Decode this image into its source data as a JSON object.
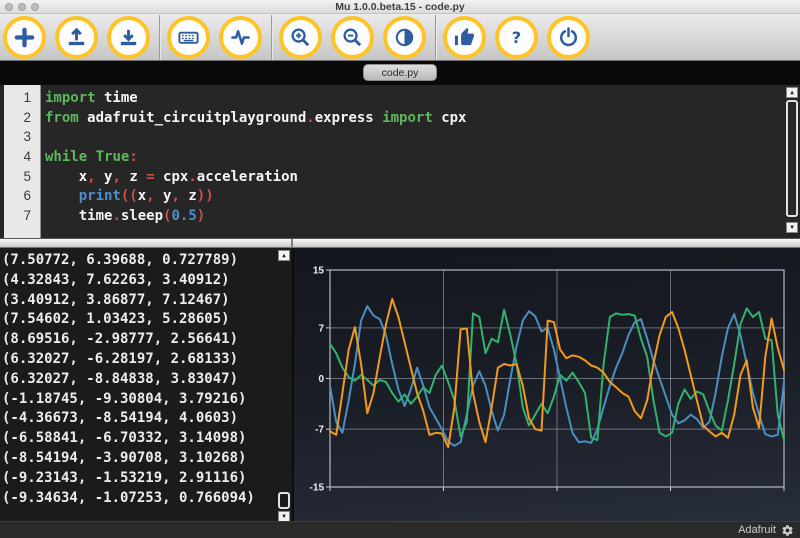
{
  "window": {
    "title": "Mu 1.0.0.beta.15 - code.py"
  },
  "toolbar": {
    "buttons": [
      {
        "id": "new",
        "icon": "plus-icon",
        "group": 1
      },
      {
        "id": "load",
        "icon": "upload-icon",
        "group": 1
      },
      {
        "id": "save",
        "icon": "download-icon",
        "group": 1
      },
      {
        "id": "serial",
        "icon": "keyboard-icon",
        "group": 2
      },
      {
        "id": "plotter",
        "icon": "waveform-icon",
        "group": 2
      },
      {
        "id": "zoom-in",
        "icon": "zoom-in-icon",
        "group": 3
      },
      {
        "id": "zoom-out",
        "icon": "zoom-out-icon",
        "group": 3
      },
      {
        "id": "theme",
        "icon": "contrast-icon",
        "group": 3
      },
      {
        "id": "check",
        "icon": "thumbs-up-icon",
        "group": 4
      },
      {
        "id": "help",
        "icon": "question-icon",
        "group": 4
      },
      {
        "id": "quit",
        "icon": "power-icon",
        "group": 4
      }
    ]
  },
  "tabs": {
    "active": "code.py"
  },
  "editor": {
    "lines": [
      {
        "num": "1",
        "tokens": [
          [
            "import",
            "kw"
          ],
          [
            " time",
            "t"
          ]
        ]
      },
      {
        "num": "2",
        "tokens": [
          [
            "from",
            "kw"
          ],
          [
            " adafruit_circuitplayground",
            "t"
          ],
          [
            ".",
            "p"
          ],
          [
            "express",
            "t"
          ],
          [
            " ",
            "t"
          ],
          [
            "import",
            "kw"
          ],
          [
            " cpx",
            "t"
          ]
        ]
      },
      {
        "num": "3",
        "tokens": []
      },
      {
        "num": "4",
        "tokens": [
          [
            "while",
            "kw"
          ],
          [
            " ",
            "t"
          ],
          [
            "True",
            "kw"
          ],
          [
            ":",
            "p"
          ]
        ]
      },
      {
        "num": "5",
        "tokens": [
          [
            "    x",
            "t"
          ],
          [
            ",",
            "p"
          ],
          [
            " y",
            "t"
          ],
          [
            ",",
            "p"
          ],
          [
            " z ",
            "t"
          ],
          [
            "=",
            "p"
          ],
          [
            " cpx",
            "t"
          ],
          [
            ".",
            "p"
          ],
          [
            "acceleration",
            "t"
          ]
        ]
      },
      {
        "num": "6",
        "tokens": [
          [
            "    ",
            "t"
          ],
          [
            "print",
            "b"
          ],
          [
            "((",
            "p"
          ],
          [
            "x",
            "t"
          ],
          [
            ",",
            "p"
          ],
          [
            " y",
            "t"
          ],
          [
            ",",
            "p"
          ],
          [
            " z",
            "t"
          ],
          [
            "))",
            "p"
          ]
        ]
      },
      {
        "num": "7",
        "tokens": [
          [
            "    time",
            "t"
          ],
          [
            ".",
            "p"
          ],
          [
            "sleep",
            "t"
          ],
          [
            "(",
            "p"
          ],
          [
            "0.5",
            "b"
          ],
          [
            ")",
            "p"
          ]
        ]
      }
    ]
  },
  "repl": {
    "lines": [
      "(7.50772, 6.39688, 0.727789)",
      "(4.32843, 7.62263, 3.40912)",
      "(3.40912, 3.86877, 7.12467)",
      "(7.54602, 1.03423, 5.28605)",
      "(8.69516, -2.98777, 2.56641)",
      "(6.32027, -6.28197, 2.68133)",
      "(6.32027, -8.84838, 3.83047)",
      "(-1.18745, -9.30804, 3.79216)",
      "(-4.36673, -8.54194, 4.0603)",
      "(-6.58841, -6.70332, 3.14098)",
      "(-8.54194, -3.90708, 3.10268)",
      "(-9.23143, -1.53219, 2.91116)",
      "(-9.34634, -1.07253, 0.766094)"
    ]
  },
  "chart_data": {
    "type": "line",
    "title": "",
    "xlabel": "",
    "ylabel": "",
    "ylim": [
      -15,
      15
    ],
    "yticks": [
      15,
      7,
      0,
      -7,
      -15
    ],
    "x_gridline_count": 5,
    "grid": true,
    "legend": false,
    "series": [
      {
        "name": "blue",
        "color": "#4a8fc0",
        "values": [
          -1,
          -6,
          -7.5,
          -3,
          2,
          8,
          10,
          8.7,
          8.2,
          6,
          2,
          -1.5,
          -3.8,
          -1.5,
          1.5,
          -1,
          -4,
          -5.5,
          -7,
          -8.7,
          -9.3,
          -8.8,
          -5,
          -1,
          1,
          -1,
          -4.5,
          -7.2,
          -5,
          0,
          4.5,
          8,
          9.3,
          8.6,
          6.5,
          7,
          4,
          0,
          -4,
          -7.5,
          -8.8,
          -8.7,
          -8.9,
          -7,
          -4,
          -1,
          1.5,
          3.5,
          6,
          7.8,
          8.2,
          5.5,
          2.5,
          0,
          -2.5,
          -5,
          -6.2,
          -5.8,
          -5,
          -5.6,
          -6.8,
          -6,
          -2,
          3,
          7,
          8.9,
          6,
          2,
          -2,
          -5,
          -7.7,
          -8,
          -7.8,
          -0.5
        ]
      },
      {
        "name": "green",
        "color": "#33b26e",
        "values": [
          4.8,
          3.5,
          1.5,
          0.2,
          -0.3,
          0.5,
          -0.2,
          -1,
          -0.2,
          -0.5,
          -2,
          -3.2,
          -2.2,
          -3.5,
          -2.5,
          -1.2,
          -2,
          0.5,
          1.8,
          -0.5,
          -3,
          -8,
          -6,
          9,
          8.5,
          3.5,
          5.5,
          5,
          9.5,
          6,
          2,
          -4,
          -6.5,
          -5,
          -3.5,
          -4.8,
          -2.5,
          0.5,
          -0.3,
          0.8,
          -0.5,
          -2,
          -8.2,
          -8.5,
          2,
          8.5,
          9,
          8.8,
          8.9,
          8.7,
          5.5,
          3,
          -3,
          -7.5,
          -8,
          -7.5,
          -3.5,
          -1.5,
          -2.8,
          -1.8,
          -2.2,
          -4.5,
          -6.5,
          -7.2,
          -3,
          2,
          7.5,
          9.7,
          8.5,
          9.2,
          5.5,
          5.3,
          -5,
          -8.5
        ]
      },
      {
        "name": "orange",
        "color": "#f29a1d",
        "values": [
          -7.3,
          -7.8,
          -2,
          4,
          7.1,
          2,
          -4.8,
          -2,
          3,
          7.5,
          11,
          8.5,
          5,
          1.5,
          -2,
          -4.5,
          -7.8,
          -7.5,
          -7.6,
          -9.5,
          -4,
          6.8,
          6.9,
          -2,
          -6,
          -8.8,
          -4,
          1.5,
          2,
          1.8,
          2,
          -1,
          -5.5,
          -7,
          -7.2,
          8,
          7.8,
          4,
          2.8,
          3.2,
          3,
          2.5,
          1.8,
          1.5,
          0.8,
          -0.5,
          -1.2,
          -2,
          -2.5,
          -4.5,
          -5.5,
          -3,
          2,
          6,
          8.5,
          9.2,
          7,
          4,
          0.5,
          -3,
          -6.5,
          -7.3,
          -8,
          -7.5,
          -8.2,
          -5,
          0.5,
          2.5,
          -4,
          -6.8,
          3,
          8.3,
          4.2,
          1.2
        ]
      }
    ]
  },
  "statusbar": {
    "mode_label": "Adafruit"
  },
  "colors": {
    "toolbar_ring": "#fdc428",
    "icon_blue": "#2d5d9f",
    "keyword_green": "#5db85c",
    "punct_red": "#d05045",
    "builtin_blue": "#4d8fcc",
    "series_blue": "#4a8fc0",
    "series_green": "#33b26e",
    "series_orange": "#f29a1d"
  }
}
